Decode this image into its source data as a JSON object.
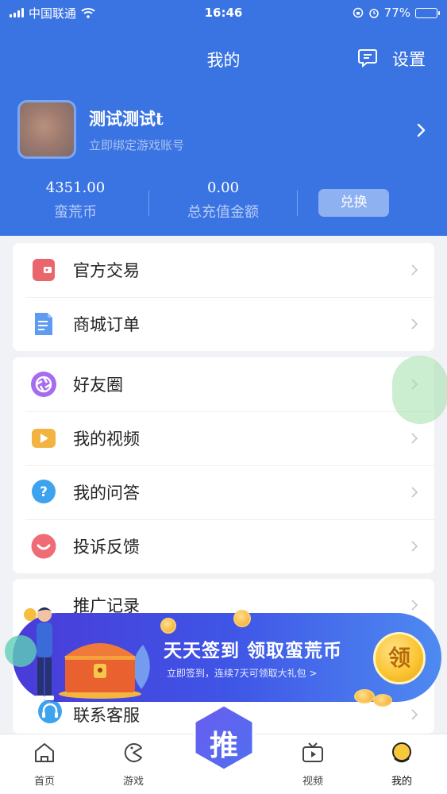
{
  "status_bar": {
    "carrier": "中国联通",
    "time": "16:46",
    "battery": "77%",
    "battery_level": 0.77
  },
  "header": {
    "title": "我的",
    "settings_label": "设置"
  },
  "profile": {
    "username": "测试测试t",
    "bind_hint": "立即绑定游戏账号"
  },
  "stats": {
    "coins_value": "4351.00",
    "coins_label": "蛮荒币",
    "recharge_value": "0.00",
    "recharge_label": "总充值金额",
    "exchange_label": "兑换"
  },
  "card1": {
    "items": [
      {
        "label": "官方交易",
        "icon": "wallet-icon",
        "color": "#e8666c"
      },
      {
        "label": "商城订单",
        "icon": "document-icon",
        "color": "#5f9bf0"
      }
    ]
  },
  "card2": {
    "items": [
      {
        "label": "好友圈",
        "icon": "aperture-icon",
        "color": "#a56bf0"
      },
      {
        "label": "我的视频",
        "icon": "video-icon",
        "color": "#f2b341"
      },
      {
        "label": "我的问答",
        "icon": "question-icon",
        "color": "#3ea3ee"
      },
      {
        "label": "投诉反馈",
        "icon": "feedback-icon",
        "color": "#ef6b76"
      }
    ]
  },
  "card3": {
    "items": [
      {
        "label": "推广记录"
      },
      {
        "label": "联系客服"
      }
    ]
  },
  "banner": {
    "title": "天天签到 领取蛮荒币",
    "subtitle": "立即签到，连续7天可领取大礼包 >",
    "claim_label": "领"
  },
  "tabbar": {
    "home": "首页",
    "games": "游戏",
    "center": "推",
    "videos": "视频",
    "mine": "我的"
  },
  "colors": {
    "brand_blue": "#3a74e3",
    "exchange_button": "#8eb1f1"
  }
}
